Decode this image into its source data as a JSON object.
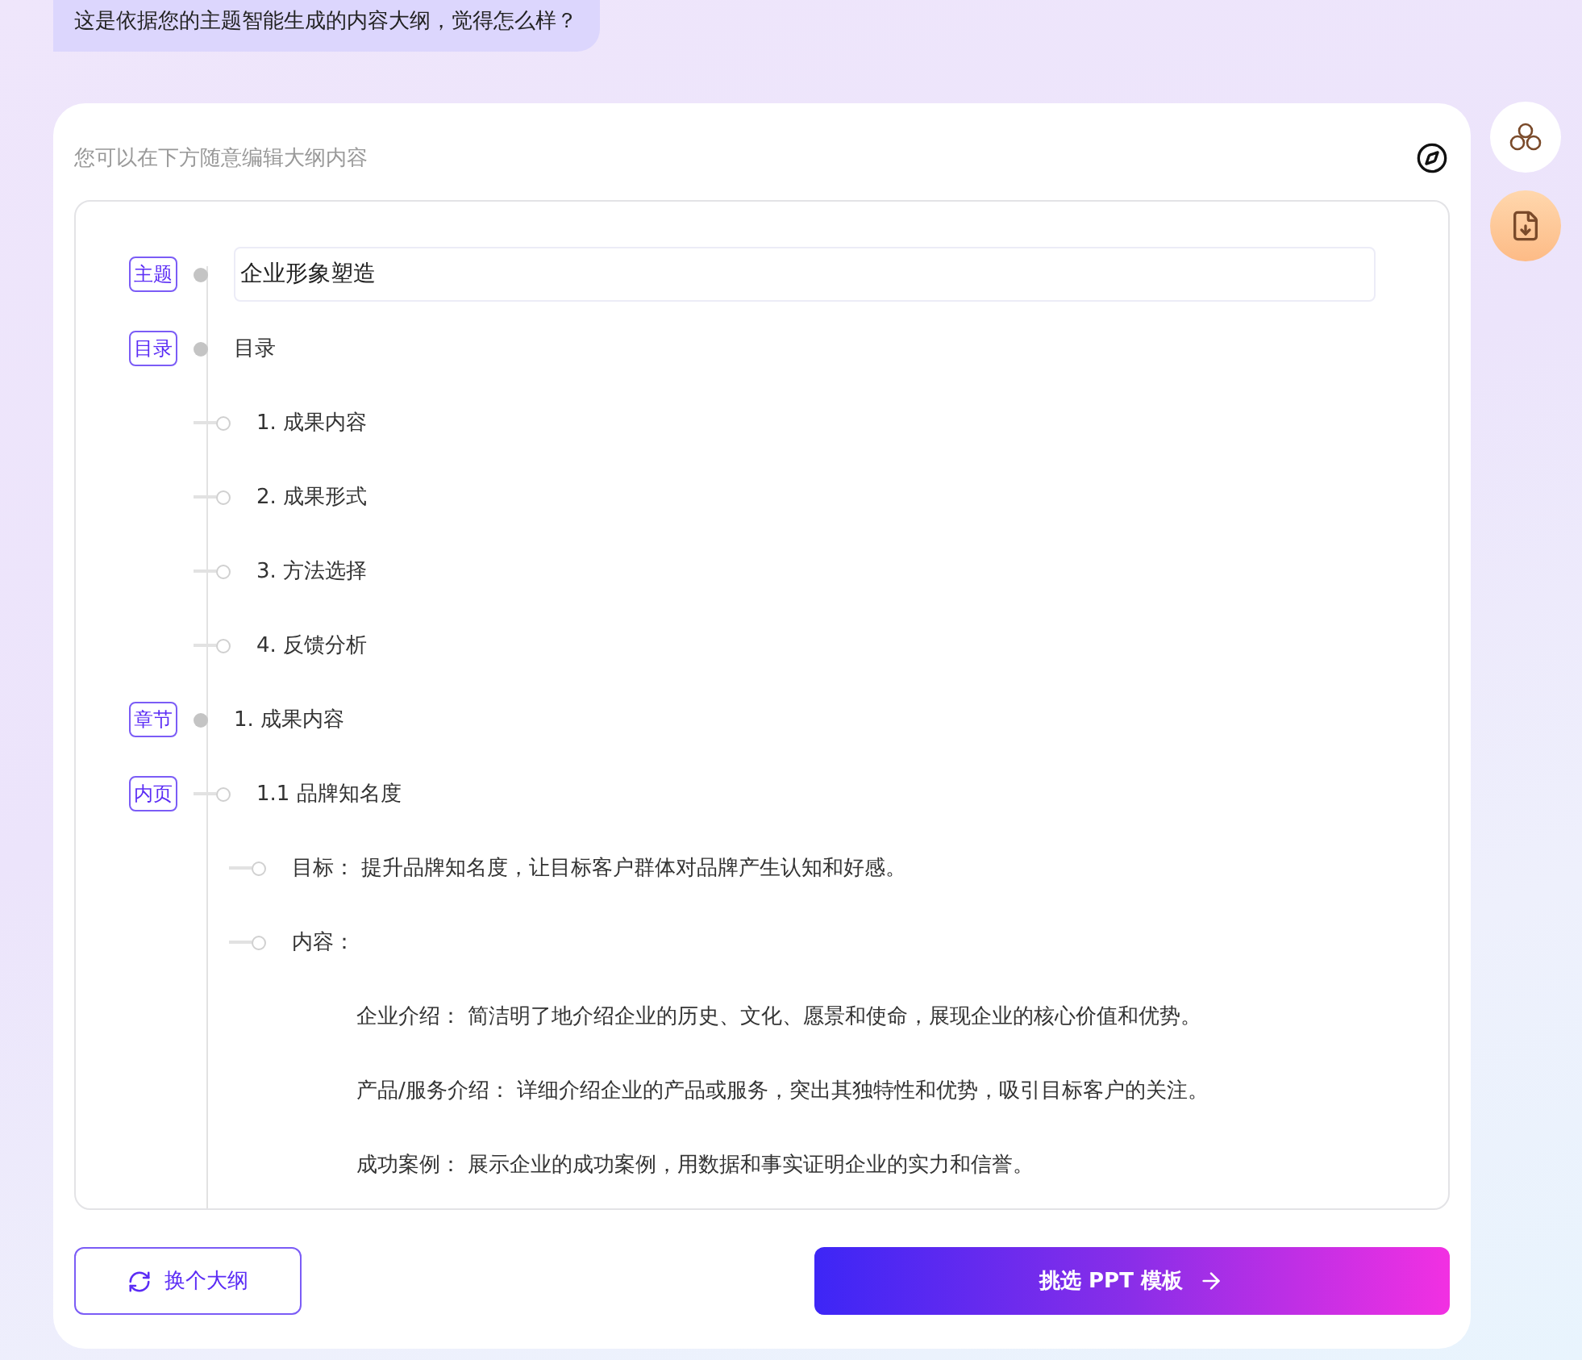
{
  "chat_bubble": "这是依据您的主题智能生成的内容大纲，觉得怎么样？",
  "editor": {
    "hint": "您可以在下方随意编辑大纲内容",
    "outline": [
      {
        "tag": "主题",
        "kind": "field",
        "text": "企业形象塑造"
      },
      {
        "tag": "目录",
        "kind": "text",
        "text": "目录",
        "children": [
          {
            "kind": "text",
            "text": "1. 成果内容"
          },
          {
            "kind": "text",
            "text": "2. 成果形式"
          },
          {
            "kind": "text",
            "text": "3. 方法选择"
          },
          {
            "kind": "text",
            "text": "4. 反馈分析"
          }
        ]
      },
      {
        "tag": "章节",
        "kind": "text",
        "text": "1. 成果内容",
        "children": [
          {
            "tag": "内页",
            "kind": "text",
            "text": "1.1 品牌知名度",
            "children": [
              {
                "kind": "text",
                "text": "目标： 提升品牌知名度，让目标客户群体对品牌产生认知和好感。"
              },
              {
                "kind": "text",
                "text": "内容：",
                "children": [
                  {
                    "kind": "text",
                    "text": "企业介绍： 简洁明了地介绍企业的历史、文化、愿景和使命，展现企业的核心价值和优势。"
                  },
                  {
                    "kind": "text",
                    "text": "产品/服务介绍： 详细介绍企业的产品或服务，突出其独特性和优势，吸引目标客户的关注。"
                  },
                  {
                    "kind": "text",
                    "text": "成功案例： 展示企业的成功案例，用数据和事实证明企业的实力和信誉。"
                  }
                ]
              }
            ]
          }
        ]
      }
    ]
  },
  "buttons": {
    "secondary": "换个大纲",
    "primary": "挑选 PPT 模板"
  }
}
